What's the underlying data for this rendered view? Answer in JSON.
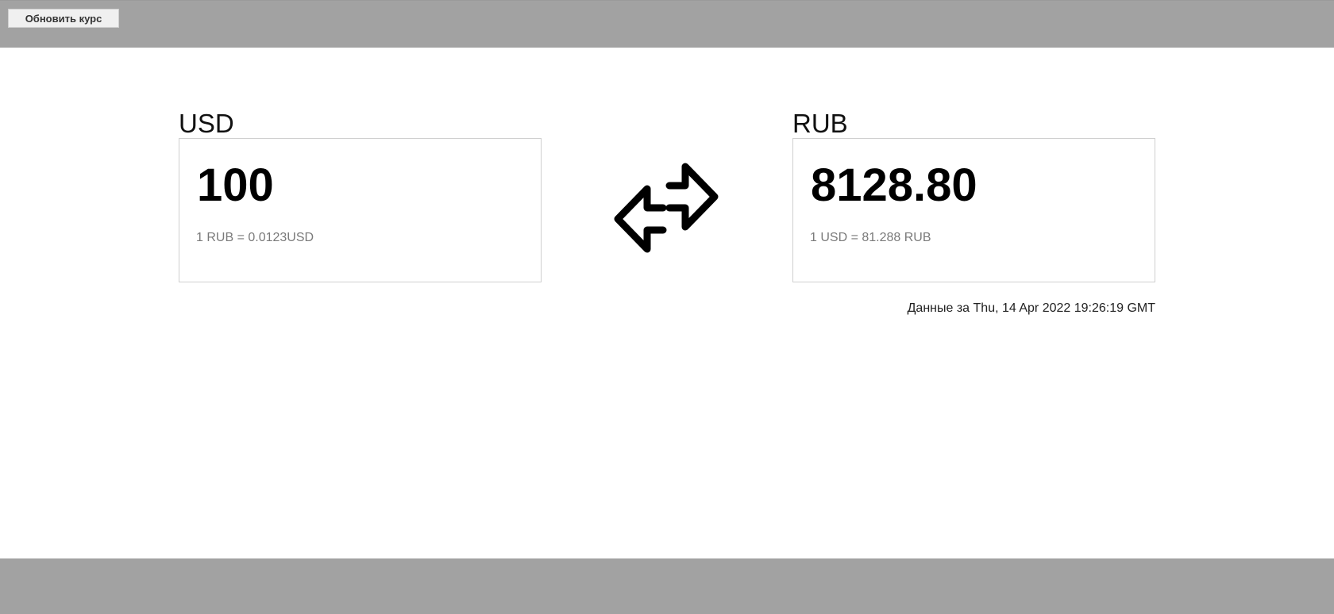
{
  "toolbar": {
    "refresh_label": "Обновить курс"
  },
  "from": {
    "code": "USD",
    "amount": "100",
    "rate": "1 RUB = 0.0123USD"
  },
  "to": {
    "code": "RUB",
    "amount": "8128.80",
    "rate": "1 USD = 81.288 RUB"
  },
  "swap": {
    "icon": "swap-arrows-icon"
  },
  "status": {
    "timestamp": "Данные за Thu, 14 Apr 2022 19:26:19 GMT"
  },
  "colors": {
    "bars": "#a2a2a2",
    "box_border": "#cfcfcf",
    "rate_text": "#7a7a7a"
  }
}
